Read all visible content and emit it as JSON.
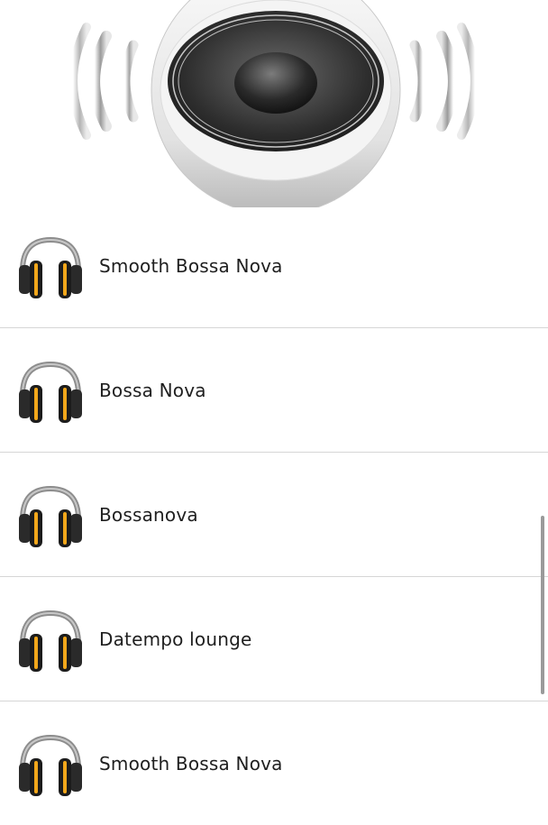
{
  "stations": [
    {
      "title": "Smooth Bossa Nova",
      "icon": "headphones-icon"
    },
    {
      "title": "Bossa Nova",
      "icon": "headphones-icon"
    },
    {
      "title": "Bossanova",
      "icon": "headphones-icon"
    },
    {
      "title": "Datempo lounge",
      "icon": "headphones-icon"
    },
    {
      "title": "Smooth Bossa Nova",
      "icon": "headphones-icon"
    }
  ],
  "header": {
    "icon": "speaker-icon"
  },
  "colors": {
    "accent": "#f2a71b",
    "background": "#ffffff",
    "divider": "#d6d6d6"
  }
}
